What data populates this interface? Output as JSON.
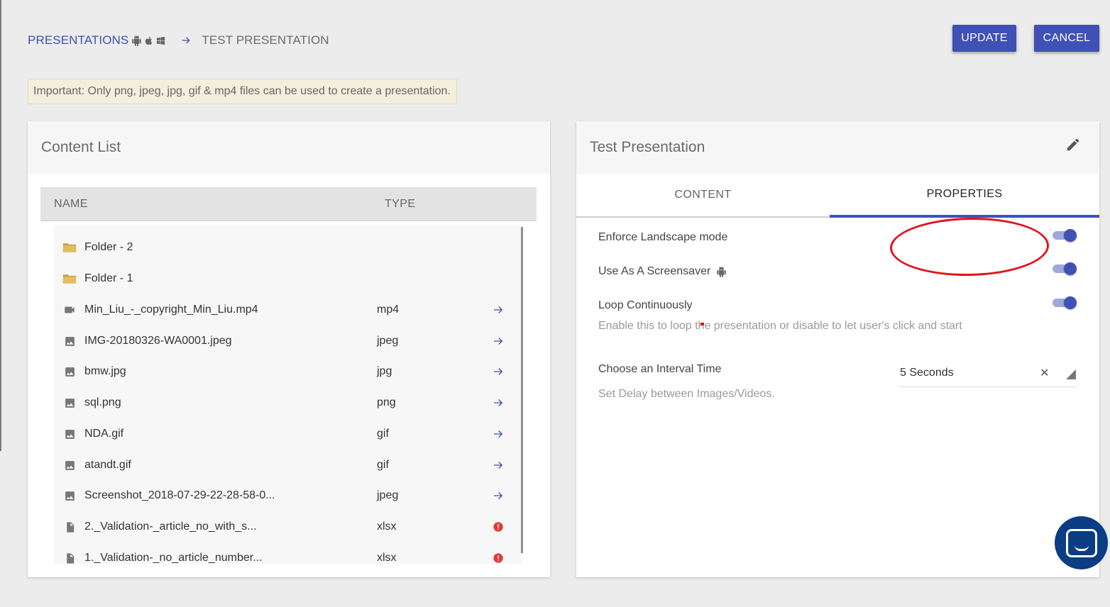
{
  "breadcrumb": {
    "root": "PRESENTATIONS",
    "current": "TEST PRESENTATION",
    "platform_icons": [
      "android-icon",
      "apple-icon",
      "windows-icon"
    ]
  },
  "actions": {
    "update": "UPDATE",
    "cancel": "CANCEL"
  },
  "notice": "Important: Only png, jpeg, jpg, gif & mp4 files can be used to create a presentation.",
  "content_list": {
    "title": "Content List",
    "columns": {
      "name": "NAME",
      "type": "TYPE"
    },
    "items": [
      {
        "icon": "folder-icon",
        "name": "Folder - 2",
        "type": "",
        "action": ""
      },
      {
        "icon": "folder-icon",
        "name": "Folder - 1",
        "type": "",
        "action": ""
      },
      {
        "icon": "video-icon",
        "name": "Min_Liu_-_copyright_Min_Liu.mp4",
        "type": "mp4",
        "action": "arrow-right-icon"
      },
      {
        "icon": "image-icon",
        "name": "IMG-20180326-WA0001.jpeg",
        "type": "jpeg",
        "action": "arrow-right-icon"
      },
      {
        "icon": "image-icon",
        "name": "bmw.jpg",
        "type": "jpg",
        "action": "arrow-right-icon"
      },
      {
        "icon": "image-icon",
        "name": "sql.png",
        "type": "png",
        "action": "arrow-right-icon"
      },
      {
        "icon": "image-icon",
        "name": "NDA.gif",
        "type": "gif",
        "action": "arrow-right-icon"
      },
      {
        "icon": "image-icon",
        "name": "atandt.gif",
        "type": "gif",
        "action": "arrow-right-icon"
      },
      {
        "icon": "image-icon",
        "name": "Screenshot_2018-07-29-22-28-58-0...",
        "type": "jpeg",
        "action": "arrow-right-icon"
      },
      {
        "icon": "file-icon",
        "name": "2._Validation-_article_no_with_s...",
        "type": "xlsx",
        "action": "error-icon"
      },
      {
        "icon": "file-icon",
        "name": "1._Validation-_no_article_number...",
        "type": "xlsx",
        "action": "error-icon"
      }
    ]
  },
  "presentation": {
    "title": "Test Presentation",
    "tabs": {
      "content": "CONTENT",
      "properties": "PROPERTIES"
    },
    "active_tab": "properties",
    "settings": {
      "landscape": {
        "label": "Enforce Landscape mode",
        "enabled": true
      },
      "screensaver": {
        "label": "Use As A Screensaver",
        "enabled": true,
        "icon": "android-icon"
      },
      "loop": {
        "label": "Loop Continuously",
        "enabled": true,
        "help": "Enable this to loop the presentation or disable to let user's click and start"
      },
      "interval": {
        "label": "Choose an Interval Time",
        "value": "5 Seconds",
        "help": "Set Delay between Images/Videos."
      }
    }
  },
  "colors": {
    "primary": "#3f51b5",
    "annotation": "#e0141b",
    "chat": "#0b3d84"
  }
}
